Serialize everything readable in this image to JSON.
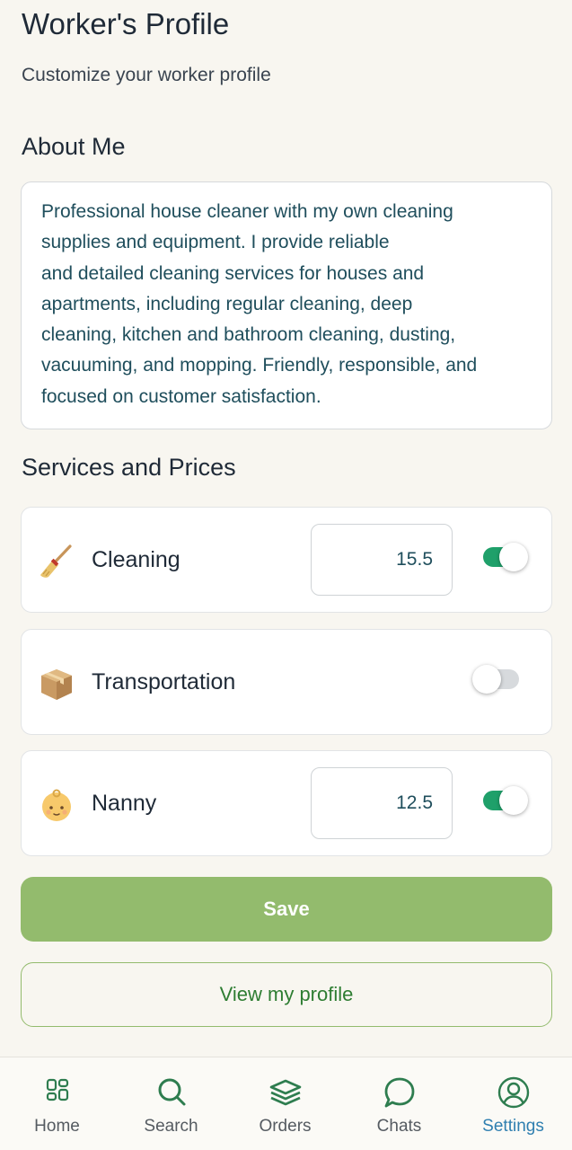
{
  "header": {
    "title": "Worker's Profile",
    "subtitle": "Customize your worker profile"
  },
  "about": {
    "heading": "About Me",
    "text": "Professional house cleaner with my own cleaning\nsupplies and equipment. I provide reliable\nand detailed cleaning services for houses and\napartments, including regular cleaning, deep\ncleaning, kitchen and bathroom cleaning, dusting,\nvacuuming, and mopping. Friendly, responsible, and\nfocused on customer satisfaction."
  },
  "services": {
    "heading": "Services and Prices",
    "items": [
      {
        "name": "Cleaning",
        "icon": "broom-icon",
        "price": "15.5",
        "enabled": true
      },
      {
        "name": "Transportation",
        "icon": "package-icon",
        "price": "",
        "enabled": false
      },
      {
        "name": "Nanny",
        "icon": "baby-icon",
        "price": "12.5",
        "enabled": true
      }
    ]
  },
  "actions": {
    "save_label": "Save",
    "view_profile_label": "View my profile"
  },
  "nav": {
    "items": [
      {
        "label": "Home",
        "icon": "grid-icon"
      },
      {
        "label": "Search",
        "icon": "search-icon"
      },
      {
        "label": "Orders",
        "icon": "layers-icon"
      },
      {
        "label": "Chats",
        "icon": "chat-icon"
      },
      {
        "label": "Settings",
        "icon": "user-circle-icon"
      }
    ],
    "active": "Settings"
  },
  "colors": {
    "background": "#f8f6f0",
    "accent_green": "#93bb6d",
    "toggle_on": "#1fa06a",
    "nav_icon": "#2e7d4f",
    "nav_active": "#2f7fb0"
  }
}
